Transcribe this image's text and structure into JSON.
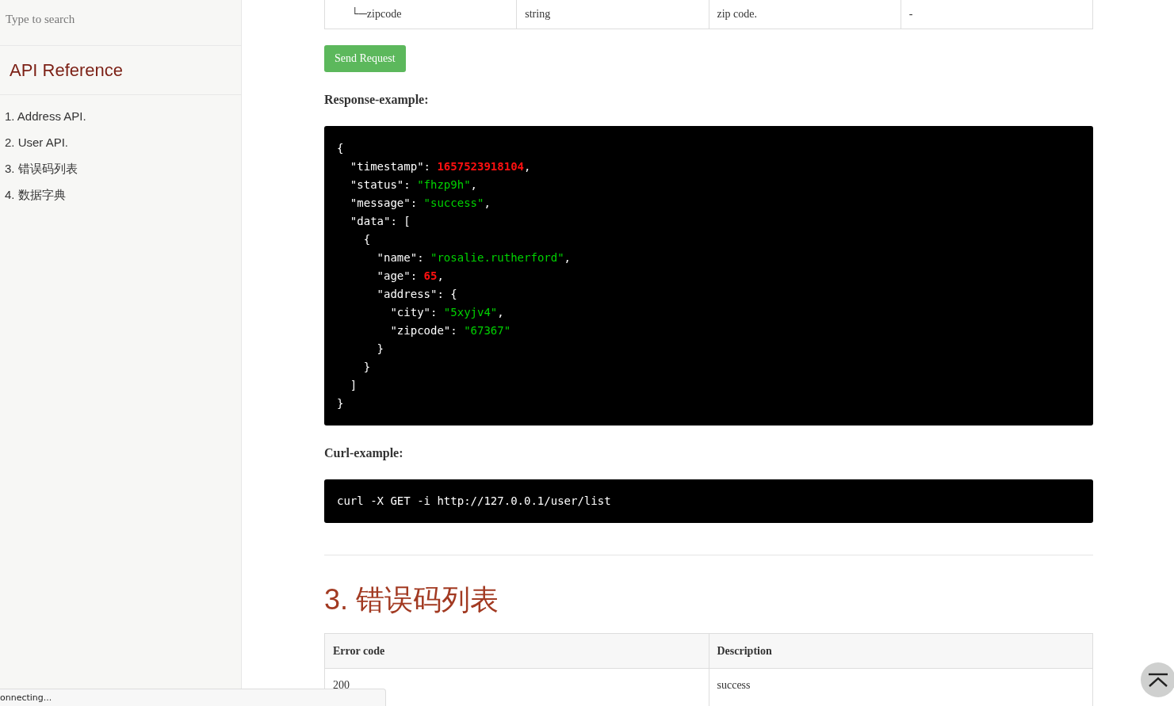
{
  "sidebar": {
    "search": {
      "placeholder": "Type to search"
    },
    "title": "API Reference",
    "items": [
      {
        "label": "1. Address API."
      },
      {
        "label": "2. User API."
      },
      {
        "label": "3. 错误码列表"
      },
      {
        "label": "4. 数据字典"
      }
    ]
  },
  "params_table": {
    "rows": [
      {
        "cells": [
          "└─zipcode",
          "string",
          "zip code.",
          "-"
        ]
      }
    ]
  },
  "send_button": "Send Request",
  "response_heading": "Response-example:",
  "response_code": [
    [
      {
        "kind": "plain",
        "text": "{"
      }
    ],
    [
      {
        "kind": "plain",
        "text": "  \"timestamp\": "
      },
      {
        "kind": "number",
        "text": "1657523918104"
      },
      {
        "kind": "plain",
        "text": ","
      }
    ],
    [
      {
        "kind": "plain",
        "text": "  \"status\": "
      },
      {
        "kind": "string",
        "text": "\"fhzp9h\""
      },
      {
        "kind": "plain",
        "text": ","
      }
    ],
    [
      {
        "kind": "plain",
        "text": "  \"message\": "
      },
      {
        "kind": "string",
        "text": "\"success\""
      },
      {
        "kind": "plain",
        "text": ","
      }
    ],
    [
      {
        "kind": "plain",
        "text": "  \"data\": ["
      }
    ],
    [
      {
        "kind": "plain",
        "text": "    {"
      }
    ],
    [
      {
        "kind": "plain",
        "text": "      \"name\": "
      },
      {
        "kind": "string",
        "text": "\"rosalie.rutherford\""
      },
      {
        "kind": "plain",
        "text": ","
      }
    ],
    [
      {
        "kind": "plain",
        "text": "      \"age\": "
      },
      {
        "kind": "number",
        "text": "65"
      },
      {
        "kind": "plain",
        "text": ","
      }
    ],
    [
      {
        "kind": "plain",
        "text": "      \"address\": {"
      }
    ],
    [
      {
        "kind": "plain",
        "text": "        \"city\": "
      },
      {
        "kind": "string",
        "text": "\"5xyjv4\""
      },
      {
        "kind": "plain",
        "text": ","
      }
    ],
    [
      {
        "kind": "plain",
        "text": "        \"zipcode\": "
      },
      {
        "kind": "string",
        "text": "\"67367\""
      }
    ],
    [
      {
        "kind": "plain",
        "text": "      }"
      }
    ],
    [
      {
        "kind": "plain",
        "text": "    }"
      }
    ],
    [
      {
        "kind": "plain",
        "text": "  ]"
      }
    ],
    [
      {
        "kind": "plain",
        "text": "}"
      }
    ]
  ],
  "curl_heading": "Curl-example:",
  "curl_code": "curl -X GET -i http://127.0.0.1/user/list",
  "section_heading": "3. 错误码列表",
  "error_table": {
    "columns": [
      "Error code",
      "Description"
    ],
    "rows": [
      {
        "cells": [
          "200",
          "success"
        ]
      }
    ]
  },
  "status_bar": "onnecting..."
}
